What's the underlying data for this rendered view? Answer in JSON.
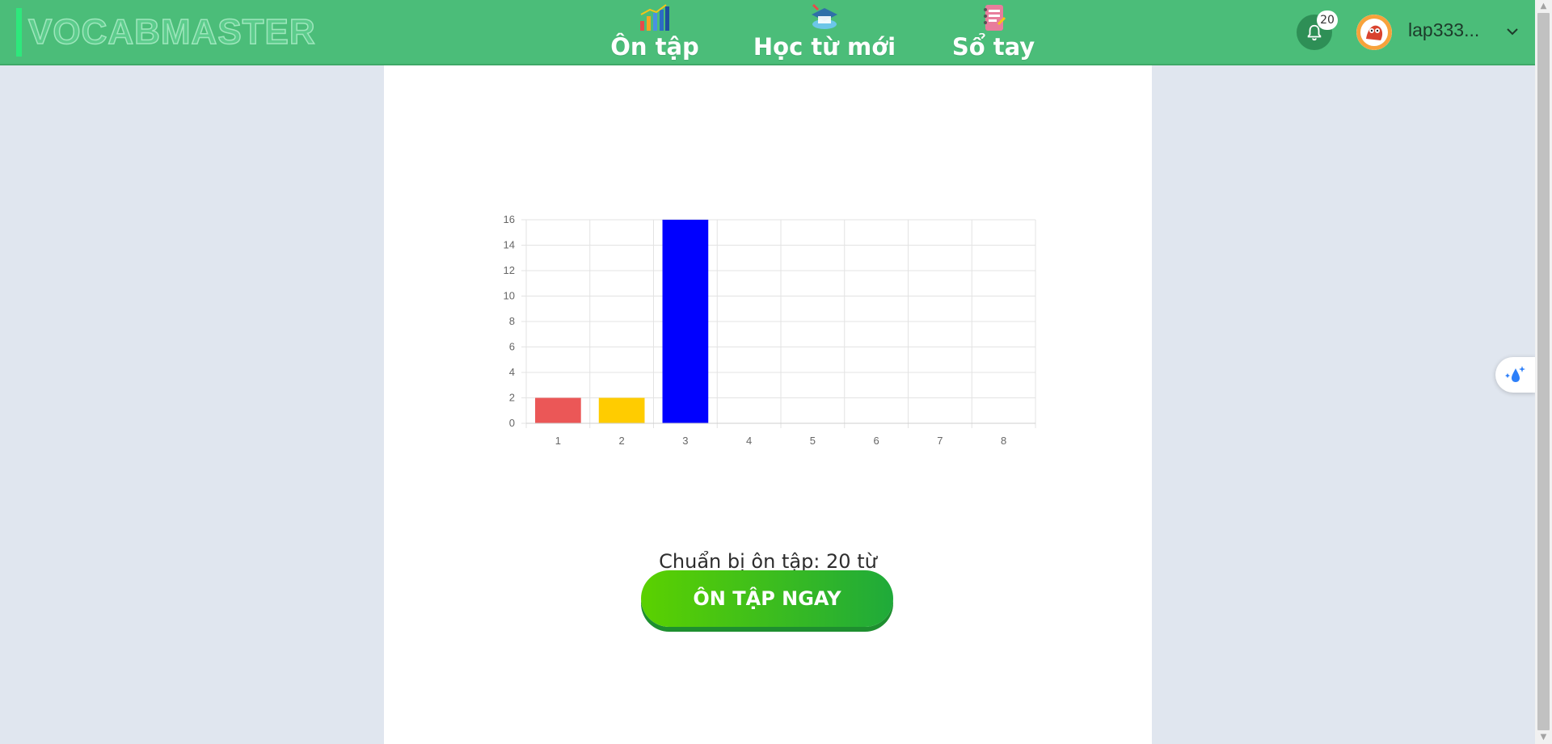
{
  "brand": {
    "logo_text": "VOCABMASTER"
  },
  "nav": {
    "items": [
      {
        "label": "Ôn tập",
        "icon": "bar-chart-icon"
      },
      {
        "label": "Học từ mới",
        "icon": "graduation-cap-icon"
      },
      {
        "label": "Sổ tay",
        "icon": "notebook-icon"
      }
    ]
  },
  "user": {
    "notification_count": "20",
    "name": "lap333..."
  },
  "review": {
    "ready_text": "Chuẩn bị ôn tập: 20 từ",
    "cta_label": "ÔN TẬP NGAY"
  },
  "colors": {
    "header": "#4bbd79",
    "accent": "#5bd100",
    "bar1": "#eb5757",
    "bar2": "#ffcc00",
    "bar3": "#0000ff"
  },
  "chart_data": {
    "type": "bar",
    "categories": [
      "1",
      "2",
      "3",
      "4",
      "5",
      "6",
      "7",
      "8"
    ],
    "values": [
      2,
      2,
      16,
      0,
      0,
      0,
      0,
      0
    ],
    "bar_colors": [
      "#eb5757",
      "#ffcc00",
      "#0000ff",
      "#cccccc",
      "#cccccc",
      "#cccccc",
      "#cccccc",
      "#cccccc"
    ],
    "yticks": [
      0,
      2,
      4,
      6,
      8,
      10,
      12,
      14,
      16
    ],
    "ylim": [
      0,
      16
    ],
    "grid": true
  }
}
